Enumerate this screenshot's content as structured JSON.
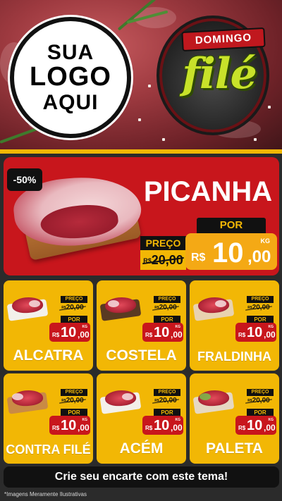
{
  "hero": {
    "logo_lines": [
      "SUA",
      "LOGO",
      "AQUI"
    ],
    "badge_top": "DOMINGO",
    "badge_word": "filé"
  },
  "featured": {
    "discount": "-50%",
    "name": "PICANHA",
    "preco_label": "PREÇO",
    "old_currency": "R$",
    "old_value": "20,00",
    "por_label": "POR",
    "new_currency": "R$",
    "new_int": "10",
    "new_dec": ",00",
    "unit": "KG"
  },
  "products": [
    {
      "name": "ALCATRA",
      "preco_label": "PREÇO",
      "old_currency": "R$",
      "old_value": "20,00",
      "por_label": "POR",
      "currency": "R$",
      "int": "10",
      "dec": ",00",
      "unit": "KG"
    },
    {
      "name": "COSTELA",
      "preco_label": "PREÇO",
      "old_currency": "R$",
      "old_value": "20,00",
      "por_label": "POR",
      "currency": "R$",
      "int": "10",
      "dec": ",00",
      "unit": "KG"
    },
    {
      "name": "FRALDINHA",
      "preco_label": "PREÇO",
      "old_currency": "R$",
      "old_value": "20,00",
      "por_label": "POR",
      "currency": "R$",
      "int": "10",
      "dec": ",00",
      "unit": "KG"
    },
    {
      "name": "CONTRA FILÉ",
      "preco_label": "PREÇO",
      "old_currency": "R$",
      "old_value": "20,00",
      "por_label": "POR",
      "currency": "R$",
      "int": "10",
      "dec": ",00",
      "unit": "KG"
    },
    {
      "name": "ACÉM",
      "preco_label": "PREÇO",
      "old_currency": "R$",
      "old_value": "20,00",
      "por_label": "POR",
      "currency": "R$",
      "int": "10",
      "dec": ",00",
      "unit": "KG"
    },
    {
      "name": "PALETA",
      "preco_label": "PREÇO",
      "old_currency": "R$",
      "old_value": "20,00",
      "por_label": "POR",
      "currency": "R$",
      "int": "10",
      "dec": ",00",
      "unit": "KG"
    }
  ],
  "footer": {
    "cta": "Crie seu encarte com este tema!",
    "disclaimer": "*Imagens Meramente Ilustrativas"
  },
  "colors": {
    "red": "#c8161c",
    "yellow": "#f2b705",
    "orange": "#f4a915",
    "dark": "#111111",
    "badge_green": "#c8e22a"
  }
}
